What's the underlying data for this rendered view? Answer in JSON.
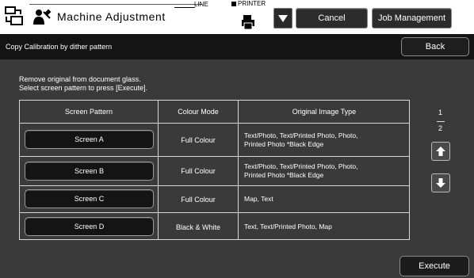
{
  "header": {
    "app_title": "Machine Adjustment",
    "line_label": "LINE",
    "printer_label": "PRINTER",
    "cancel_label": "Cancel",
    "job_management_label": "Job Management"
  },
  "subheader": {
    "title": "Copy Calibration by dither pattern",
    "back_label": "Back"
  },
  "instructions": {
    "line1": "Remove original from document glass.",
    "line2": "Select screen pattern to press [Execute]."
  },
  "table": {
    "columns": [
      "Screen Pattern",
      "Colour Mode",
      "Original Image Type"
    ],
    "rows": [
      {
        "pattern": "Screen A",
        "mode": "Full Colour",
        "type_line1": "Text/Photo, Text/Printed Photo, Photo,",
        "type_line2": "Printed Photo *Black Edge"
      },
      {
        "pattern": "Screen B",
        "mode": "Full Colour",
        "type_line1": "Text/Photo, Text/Printed Photo, Photo,",
        "type_line2": "Printed Photo *Black Edge"
      },
      {
        "pattern": "Screen C",
        "mode": "Full Colour",
        "type_line1": "Map, Text",
        "type_line2": ""
      },
      {
        "pattern": "Screen D",
        "mode": "Black & White",
        "type_line1": "Text, Text/Printed Photo, Map",
        "type_line2": ""
      }
    ]
  },
  "pager": {
    "current": "1",
    "total": "2"
  },
  "footer": {
    "execute_label": "Execute"
  },
  "icons": {
    "app": "settings-adjust-icon",
    "person": "person-wrench-icon",
    "printer": "printer-icon",
    "dropdown": "triangle-down-icon",
    "up": "arrow-up-icon",
    "down": "arrow-down-icon"
  }
}
